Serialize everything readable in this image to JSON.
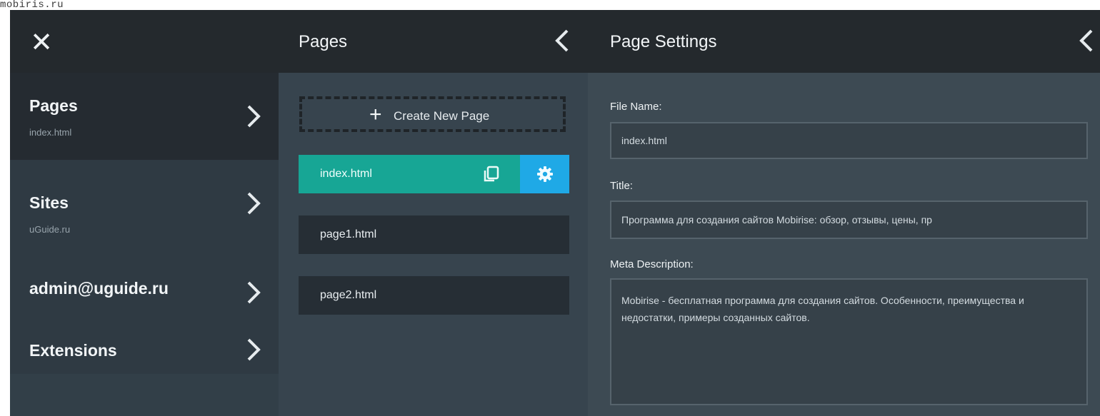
{
  "watermark": "mobiris.ru",
  "menu": {
    "items": [
      {
        "title": "Pages",
        "subtitle": "index.html"
      },
      {
        "title": "Sites",
        "subtitle": "uGuide.ru"
      },
      {
        "title": "admin@uguide.ru",
        "subtitle": ""
      },
      {
        "title": "Extensions",
        "subtitle": ""
      }
    ]
  },
  "pages_panel": {
    "title": "Pages",
    "create_label": "Create New Page",
    "pages": [
      "index.html",
      "page1.html",
      "page2.html"
    ]
  },
  "settings": {
    "title": "Page Settings",
    "file_name_label": "File Name:",
    "file_name_value": "index.html",
    "title_label": "Title:",
    "title_value": "Программа для создания сайтов Mobirise: обзор, отзывы, цены, пр",
    "meta_label": "Meta Description:",
    "meta_value": "Mobirise - бесплатная программа для создания сайтов. Особенности, преимущества и недостатки, примеры созданных сайтов."
  },
  "colors": {
    "active_page": "#17a695",
    "settings_button": "#1fa9e6",
    "header": "#24292d"
  }
}
